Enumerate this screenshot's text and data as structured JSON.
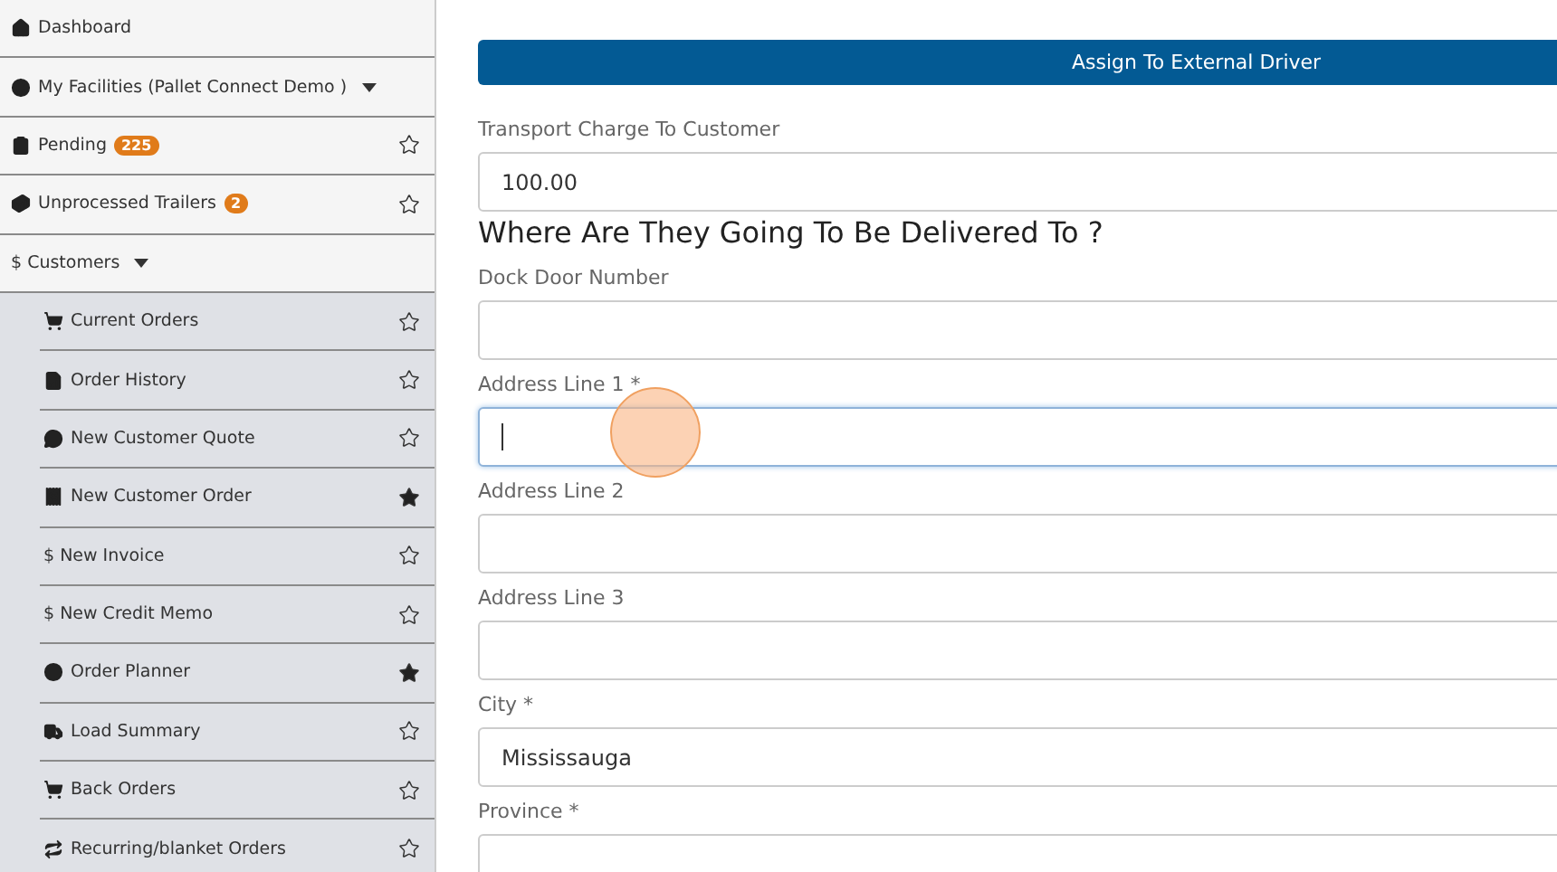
{
  "sidebar": {
    "items": [
      {
        "label": "Dashboard"
      },
      {
        "label": "My Facilities (Pallet Connect Demo )",
        "dropdown": true
      },
      {
        "label": "Pending",
        "badge": "225",
        "starred": false
      },
      {
        "label": "Unprocessed Trailers",
        "badge": "2",
        "starred": false
      },
      {
        "label": "$ Customers",
        "dropdown": true,
        "children": [
          {
            "label": "Current Orders",
            "starred": false
          },
          {
            "label": "Order History",
            "starred": false
          },
          {
            "label": "New Customer Quote",
            "starred": false
          },
          {
            "label": "New Customer Order",
            "starred": true
          },
          {
            "label": "$ New Invoice",
            "starred": false
          },
          {
            "label": "$ New Credit Memo",
            "starred": false
          },
          {
            "label": "Order Planner",
            "starred": true
          },
          {
            "label": "Load Summary",
            "starred": false
          },
          {
            "label": "Back Orders",
            "starred": false
          },
          {
            "label": "Recurring/blanket Orders",
            "starred": false
          }
        ]
      }
    ]
  },
  "form": {
    "button": "Assign To External Driver",
    "fields_top": [
      {
        "label": "Transport Charge To Customer",
        "value": "100.00",
        "focused": false
      }
    ],
    "heading": "Where Are They Going To Be Delivered To ?",
    "fields": [
      {
        "label": "Dock Door Number",
        "focused": false
      },
      {
        "label": "Address Line 1 *",
        "focused": true
      },
      {
        "label": "Address Line 2",
        "focused": false
      },
      {
        "label": "Address Line 3",
        "focused": false
      },
      {
        "label": "City *",
        "value": "Mississauga",
        "focused": false
      },
      {
        "label": "Province *",
        "focused": false
      }
    ]
  }
}
